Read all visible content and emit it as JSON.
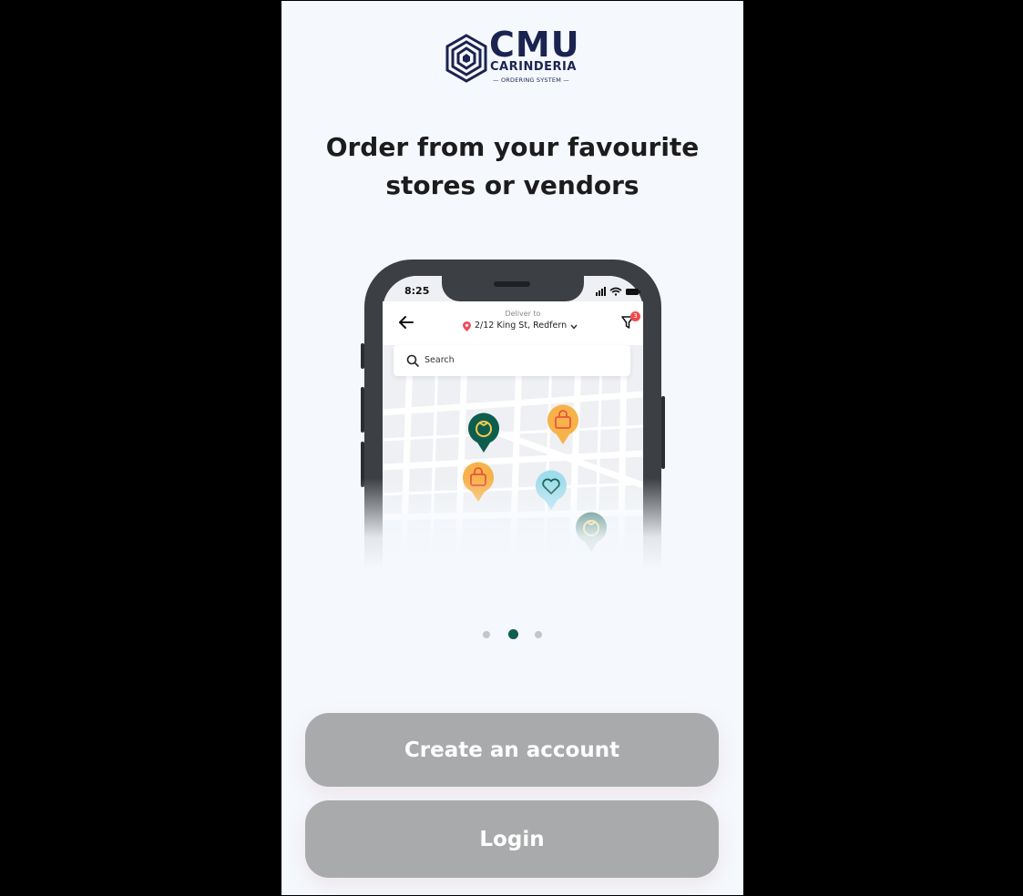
{
  "logo": {
    "title": "CMU",
    "subtitle": "CARINDERIA",
    "tagline": "ORDERING SYSTEM"
  },
  "onboarding": {
    "headline": "Order from your favourite stores or vendors",
    "page_count": 3,
    "active_page": 2
  },
  "phone_mockup": {
    "status_time": "8:25",
    "deliver_label": "Deliver to",
    "deliver_address": "2/12 King St, Redfern",
    "filter_badge": "3",
    "search_placeholder": "Search",
    "pin_icons": [
      "tomato-icon",
      "shopping-bag-icon",
      "shopping-bag-icon",
      "heart-icon",
      "tomato-icon"
    ]
  },
  "actions": {
    "create_account_label": "Create an account",
    "login_label": "Login"
  },
  "colors": {
    "background": "#000000",
    "panel": "#f5f8fd",
    "headline": "#1c1c1c",
    "logo": "#1b2350",
    "button": "#a9aaab",
    "button_text": "#ffffff",
    "active_dot": "#0e5e4e",
    "inactive_dot": "#c3c7cc",
    "pin_green": "#0e5e4e",
    "pin_orange": "#f7b24a",
    "pin_blue": "#9fdcec"
  }
}
